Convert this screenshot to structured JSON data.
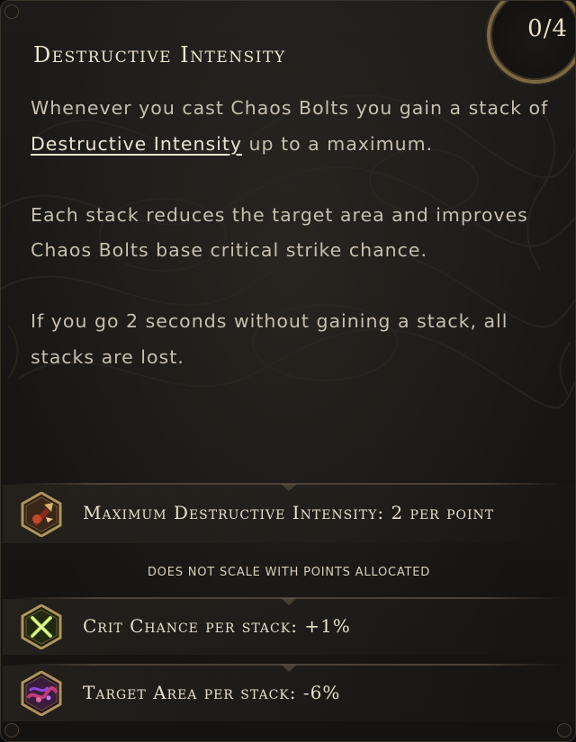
{
  "counter": {
    "text": "0/4"
  },
  "title": "Destructive Intensity",
  "description": {
    "p1_before": "Whenever you cast Chaos Bolts you gain a stack of ",
    "p1_keyword": "Destructive Intensity",
    "p1_after": " up to a maximum.",
    "p2": "Each stack reduces the target area and improves Chaos Bolts base critical strike chance.",
    "p3": "If you go 2 seconds without gaining a stack, all stacks are lost."
  },
  "stats": [
    {
      "icon": "destructive-intensity-skill-icon",
      "label": "Maximum Destructive Intensity: 2 per point"
    },
    {
      "icon": "crit-chance-skill-icon",
      "label": "Crit Chance per stack: +1%"
    },
    {
      "icon": "target-area-skill-icon",
      "label": "Target Area per stack: -6%"
    }
  ],
  "note": "does not scale with points allocated",
  "colors": {
    "background": "#1a1816",
    "title": "#efe6cf",
    "body_text": "#c7bfae",
    "ring_gold": "#7b6840",
    "icon_frame_gold": "#b0955a"
  }
}
